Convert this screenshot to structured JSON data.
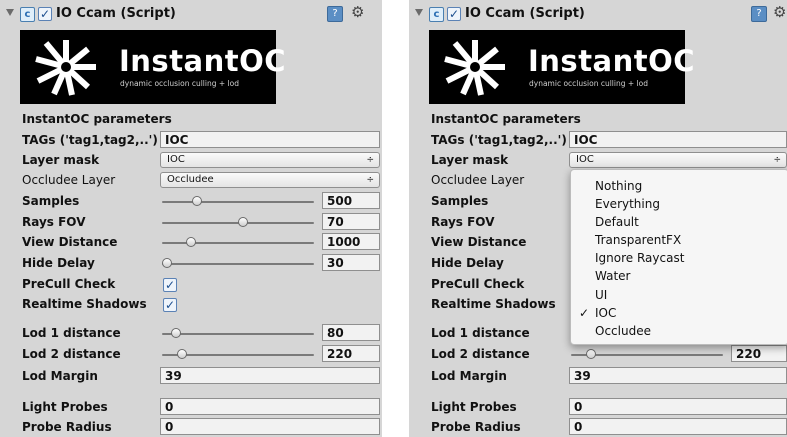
{
  "header": {
    "title": "IO Ccam (Script)",
    "enabled_check": "✓"
  },
  "logo": {
    "title": "InstantOC",
    "subtitle": "dynamic occlusion culling + lod"
  },
  "section_title": "InstantOC parameters",
  "fields": {
    "tags": {
      "label": "TAGs ('tag1,tag2,..')",
      "value": "IOC"
    },
    "layer_mask": {
      "label": "Layer mask",
      "value": "IOC",
      "arrow": "÷"
    },
    "occludee_layer": {
      "label": "Occludee Layer",
      "value": "Occludee",
      "arrow": "÷"
    },
    "samples": {
      "label": "Samples",
      "value": "500",
      "level": 0.23
    },
    "rays_fov": {
      "label": "Rays FOV",
      "value": "70",
      "level": 0.53
    },
    "view_distance": {
      "label": "View Distance",
      "value": "1000",
      "level": 0.19
    },
    "hide_delay": {
      "label": "Hide Delay",
      "value": "30",
      "level": 0.03
    },
    "precull_check": {
      "label": "PreCull Check",
      "checked": true,
      "mark": "✓"
    },
    "realtime_shadows": {
      "label": "Realtime Shadows",
      "checked": true,
      "mark": "✓"
    },
    "lod1": {
      "label": "Lod 1 distance",
      "value": "80",
      "level": 0.09
    },
    "lod2": {
      "label": "Lod 2 distance",
      "value": "220",
      "level": 0.13
    },
    "lod_margin": {
      "label": "Lod Margin",
      "value": "39"
    },
    "light_probes": {
      "label": "Light Probes",
      "value": "0"
    },
    "probe_radius": {
      "label": "Probe Radius",
      "value": "0"
    }
  },
  "layer_menu": {
    "items": [
      "Nothing",
      "Everything",
      "Default",
      "TransparentFX",
      "Ignore Raycast",
      "Water",
      "UI",
      "IOC",
      "Occludee"
    ],
    "selected": "IOC",
    "check_mark": "✓"
  },
  "colors": {
    "panel_bg": "#d6d6d6",
    "field_bg": "#f2f2f2",
    "logo_bg": "#000000",
    "accent": "#5b8ec4"
  }
}
